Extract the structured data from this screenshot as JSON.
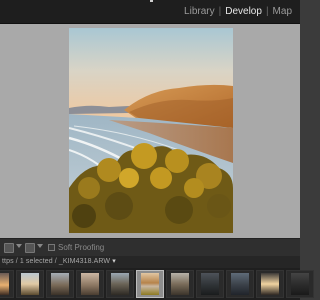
{
  "app": {
    "modules": [
      {
        "label": "Library",
        "active": false
      },
      {
        "label": "Develop",
        "active": true
      },
      {
        "label": "Map",
        "active": false
      }
    ],
    "separator": "|"
  },
  "viewer": {
    "photo_name": "_KIM4318.ARW",
    "background_color": "#a9a9a9"
  },
  "toolbar": {
    "view_icon_1": "loupe-view-icon",
    "view_icon_2": "before-after-icon",
    "soft_proofing_label": "Soft Proofing"
  },
  "filmstrip": {
    "path_prefix": "ttps / 1 selected / ",
    "selected_file": "_KIM4318.ARW",
    "dropdown_icon": "chevron-down-icon",
    "thumbnails": [
      {
        "tone": "sunset",
        "selected": false
      },
      {
        "tone": "beach",
        "selected": false
      },
      {
        "tone": "rocks",
        "selected": false
      },
      {
        "tone": "dusk",
        "selected": false
      },
      {
        "tone": "cliff",
        "selected": false
      },
      {
        "tone": "beach-yellow",
        "selected": true
      },
      {
        "tone": "rocks",
        "selected": false
      },
      {
        "tone": "dark-sea",
        "selected": false
      },
      {
        "tone": "dark-coast",
        "selected": false
      },
      {
        "tone": "sunset-bright",
        "selected": false
      },
      {
        "tone": "dark-rocks",
        "selected": false
      }
    ]
  }
}
